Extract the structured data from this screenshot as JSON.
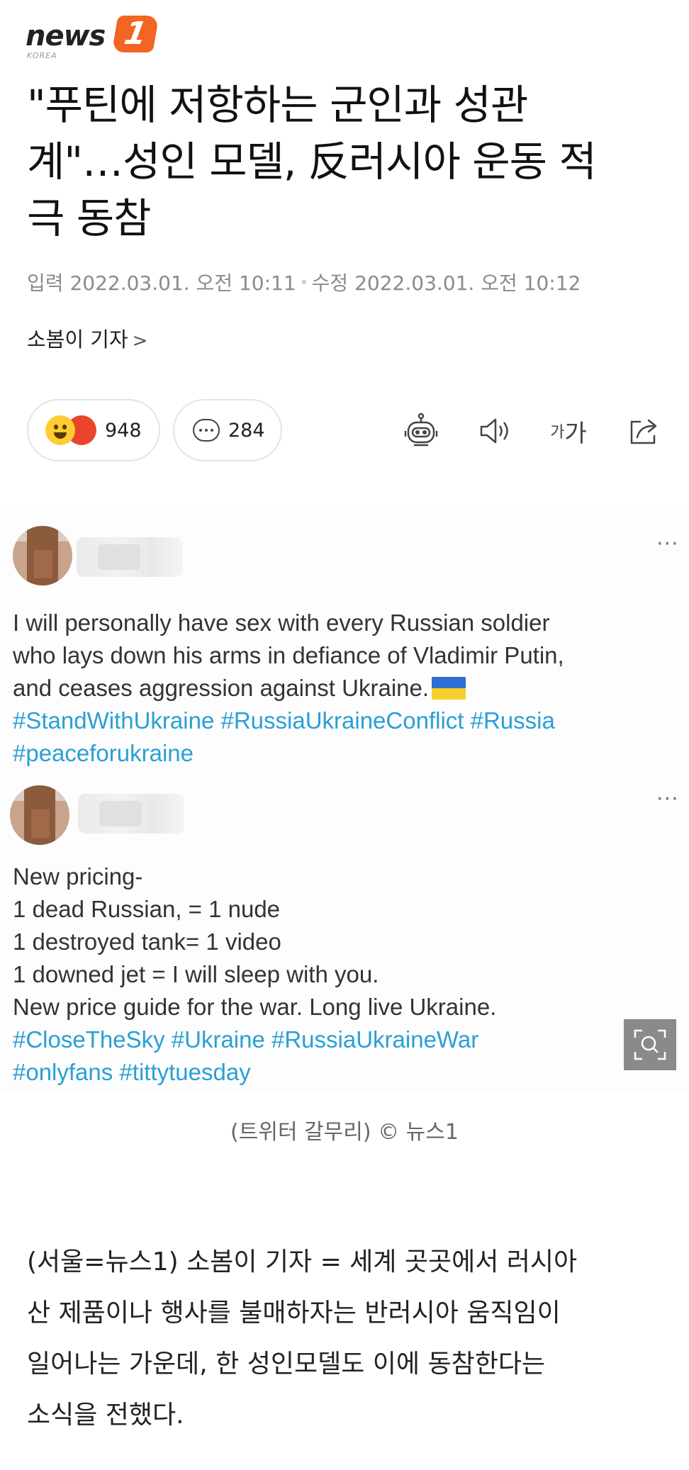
{
  "logo": {
    "word": "news",
    "badge": "1",
    "sub": "KOREA"
  },
  "article": {
    "title_lines": [
      "\"푸틴에 저항하는 군인과 성관",
      "계\"…성인 모델, 反러시아 운동 적",
      "극 동참"
    ],
    "input_label": "입력",
    "input_time": "2022.03.01. 오전 10:11",
    "modified_label": "수정",
    "modified_time": "2022.03.01. 오전 10:12",
    "reporter": "소봄이 기자",
    "reporter_chevron": ">"
  },
  "actions": {
    "reaction_count": "948",
    "comment_count": "284",
    "fontsize_small": "가",
    "fontsize_large": "가"
  },
  "tweets": [
    {
      "more": "···",
      "lines": [
        "I will personally have sex with every Russian soldier",
        "who lays down his arms in defiance of Vladimir Putin,",
        "and ceases aggression against Ukraine."
      ],
      "hashtag_lines": [
        "#StandWithUkraine #RussiaUkraineConflict #Russia",
        "#peaceforukraine"
      ]
    },
    {
      "more": "···",
      "lines": [
        "New pricing-",
        "1 dead Russian, = 1 nude",
        "1 destroyed tank= 1 video",
        "1 downed jet = I will sleep with you.",
        "New price guide for the war. Long live Ukraine."
      ],
      "hashtag_lines": [
        "#CloseTheSky #Ukraine #RussiaUkraineWar",
        "#onlyfans #tittytuesday"
      ]
    }
  ],
  "image_caption": "(트위터 갈무리) © 뉴스1",
  "body_lines": [
    "(서울=뉴스1) 소봄이 기자 = 세계 곳곳에서 러시아",
    "산 제품이나 행사를 불매하자는 반러시아 움직임이",
    "일어나는 가운데, 한 성인모델도 이에 동참한다는",
    "소식을 전했다."
  ],
  "colors": {
    "brand": "#f26522",
    "hashtag": "#2a9fd6",
    "zoom_bg": "#8a8a8a"
  },
  "icons": [
    "emoji-happy-icon",
    "emoji-angry-icon",
    "comment-icon",
    "robot-icon",
    "speaker-icon",
    "font-size-icon",
    "share-icon",
    "image-zoom-icon",
    "ukraine-flag-icon"
  ]
}
